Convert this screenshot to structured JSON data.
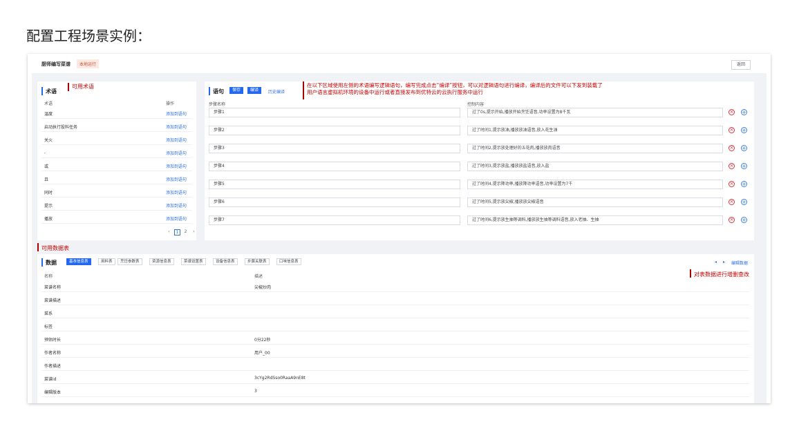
{
  "page_heading": "配置工程场景实例：",
  "app": {
    "title": "厨师编写菜谱",
    "badge": "本地运行",
    "back_label": "返回"
  },
  "terms": {
    "title": "术语",
    "annotation": "可用术语",
    "col_term": "术语",
    "col_op": "操作",
    "rows": [
      {
        "term": "温度",
        "op": "添加到语句"
      },
      {
        "term": "启动执行投料任务",
        "op": "添加到语句"
      },
      {
        "term": "关火",
        "op": "添加到语句"
      },
      {
        "term": ",",
        "op": "添加到语句"
      },
      {
        "term": "或",
        "op": "添加到语句"
      },
      {
        "term": "且",
        "op": "添加到语句"
      },
      {
        "term": "同时",
        "op": "添加到语句"
      },
      {
        "term": "提示",
        "op": "添加到语句"
      },
      {
        "term": "播放",
        "op": "添加到语句"
      }
    ],
    "pagination": {
      "prev": "‹",
      "pages": [
        "1",
        "2"
      ],
      "next": "›"
    }
  },
  "statements": {
    "title": "语句",
    "save_label": "保存",
    "compile_label": "编译",
    "history_label": "历史编译",
    "annotation_line1": "在以下区域使用左侧的术语编写逻辑语句，编写完成点击“编译”按钮，可以对逻辑语句进行编译，编译后的文件可以下发到装载了",
    "annotation_line2": "用户语言虚拟机环境的设备中运行或者直接发布到优特云的云执行服务中运行",
    "col_step": "步骤名称",
    "col_content": "控制内容",
    "rows": [
      {
        "step": "步骤1",
        "content": "过了0s,提示开始,播放开始烹饪语音,功率设置为8千瓦"
      },
      {
        "step": "步骤2",
        "content": "过了时间1,提示放油,播放放油语音,放入花生油"
      },
      {
        "step": "步骤3",
        "content": "过了时间2,提示放处理好的五花肉,播放放肉语音"
      },
      {
        "step": "步骤4",
        "content": "过了时间3,提示放盐,播放放盐语音,放入盐"
      },
      {
        "step": "步骤5",
        "content": "过了时间4,提示降功率,播放降功率语音,功率设置为7千"
      },
      {
        "step": "步骤6",
        "content": "过了时间5,提示放尖椒,播放放尖椒语音"
      },
      {
        "step": "步骤7",
        "content": "过了时间6,提示放生抽等调料,播放放生抽等调料语音,放入老抽、生抽"
      }
    ]
  },
  "data_panel": {
    "annotation_top": "可用数据表",
    "annotation_right": "对表数据进行增删查改",
    "title": "数据",
    "tabs": [
      "基本信息表",
      "用料表",
      "烹饪参数表",
      "资源信息表",
      "菜谱设置表",
      "设备信息表",
      "步骤关联表",
      "口味信息表"
    ],
    "edit_label": "编辑数据",
    "col_name": "名称",
    "col_desc": "描述",
    "rows": [
      {
        "name": "菜谱名称",
        "desc": "尖椒炒肉"
      },
      {
        "name": "菜谱描述",
        "desc": ""
      },
      {
        "name": "菜系",
        "desc": ""
      },
      {
        "name": "标签",
        "desc": ""
      },
      {
        "name": "预估时长",
        "desc": "0分22秒"
      },
      {
        "name": "作者名称",
        "desc": "用户_00"
      },
      {
        "name": "作者描述",
        "desc": ""
      },
      {
        "name": "菜谱id",
        "desc": "3cYg2RdSso0RaaA9nE8t"
      },
      {
        "name": "编辑版本",
        "desc": "3"
      }
    ]
  },
  "colors": {
    "accent": "#2468f2",
    "annotation_red": "#cc0000",
    "delete_red": "#e0303a"
  }
}
